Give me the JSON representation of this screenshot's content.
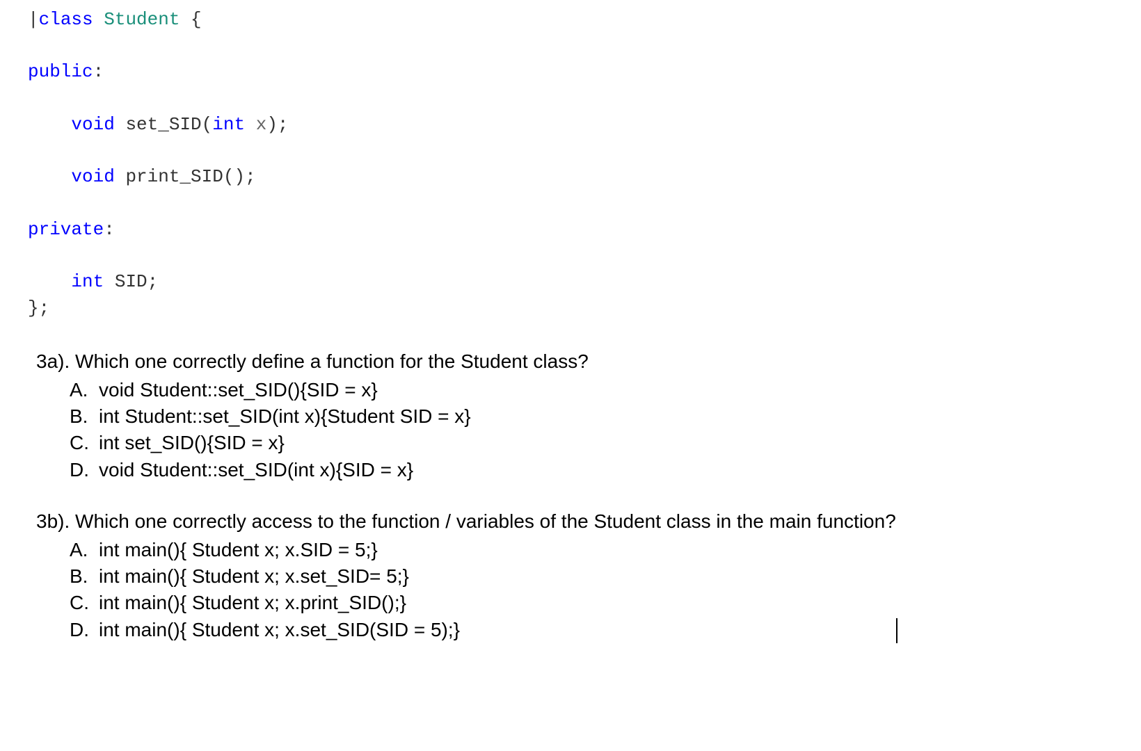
{
  "code": {
    "l1_kw": "class",
    "l1_id": "Student",
    "l1_rest": " {",
    "l2_kw": "public",
    "l2_rest": ":",
    "l3_type": "void",
    "l3_rest1": " set_SID(",
    "l3_type2": "int",
    "l3_param": " x",
    "l3_rest2": ");",
    "l4_type": "void",
    "l4_rest": " print_SID();",
    "l5_kw": "private",
    "l5_rest": ":",
    "l6_type": "int",
    "l6_rest": " SID;",
    "l7": "};"
  },
  "q3a": {
    "prompt": "3a). Which one correctly define a function for the Student class?",
    "options": [
      {
        "letter": "A.",
        "text": "void Student::set_SID(){SID = x}"
      },
      {
        "letter": "B.",
        "text": "int Student::set_SID(int x){Student SID = x}"
      },
      {
        "letter": "C.",
        "text": "int set_SID(){SID = x}"
      },
      {
        "letter": "D.",
        "text": "void Student::set_SID(int x){SID = x}"
      }
    ]
  },
  "q3b": {
    "prompt": "3b). Which one correctly access to the function / variables of the Student class in the main function?",
    "options": [
      {
        "letter": "A.",
        "text": "int main(){ Student x; x.SID = 5;}"
      },
      {
        "letter": "B.",
        "text": "int main(){ Student x; x.set_SID= 5;}"
      },
      {
        "letter": "C.",
        "text": "int main(){ Student x; x.print_SID();}"
      },
      {
        "letter": "D.",
        "text": "int main(){ Student x; x.set_SID(SID = 5);}"
      }
    ]
  }
}
